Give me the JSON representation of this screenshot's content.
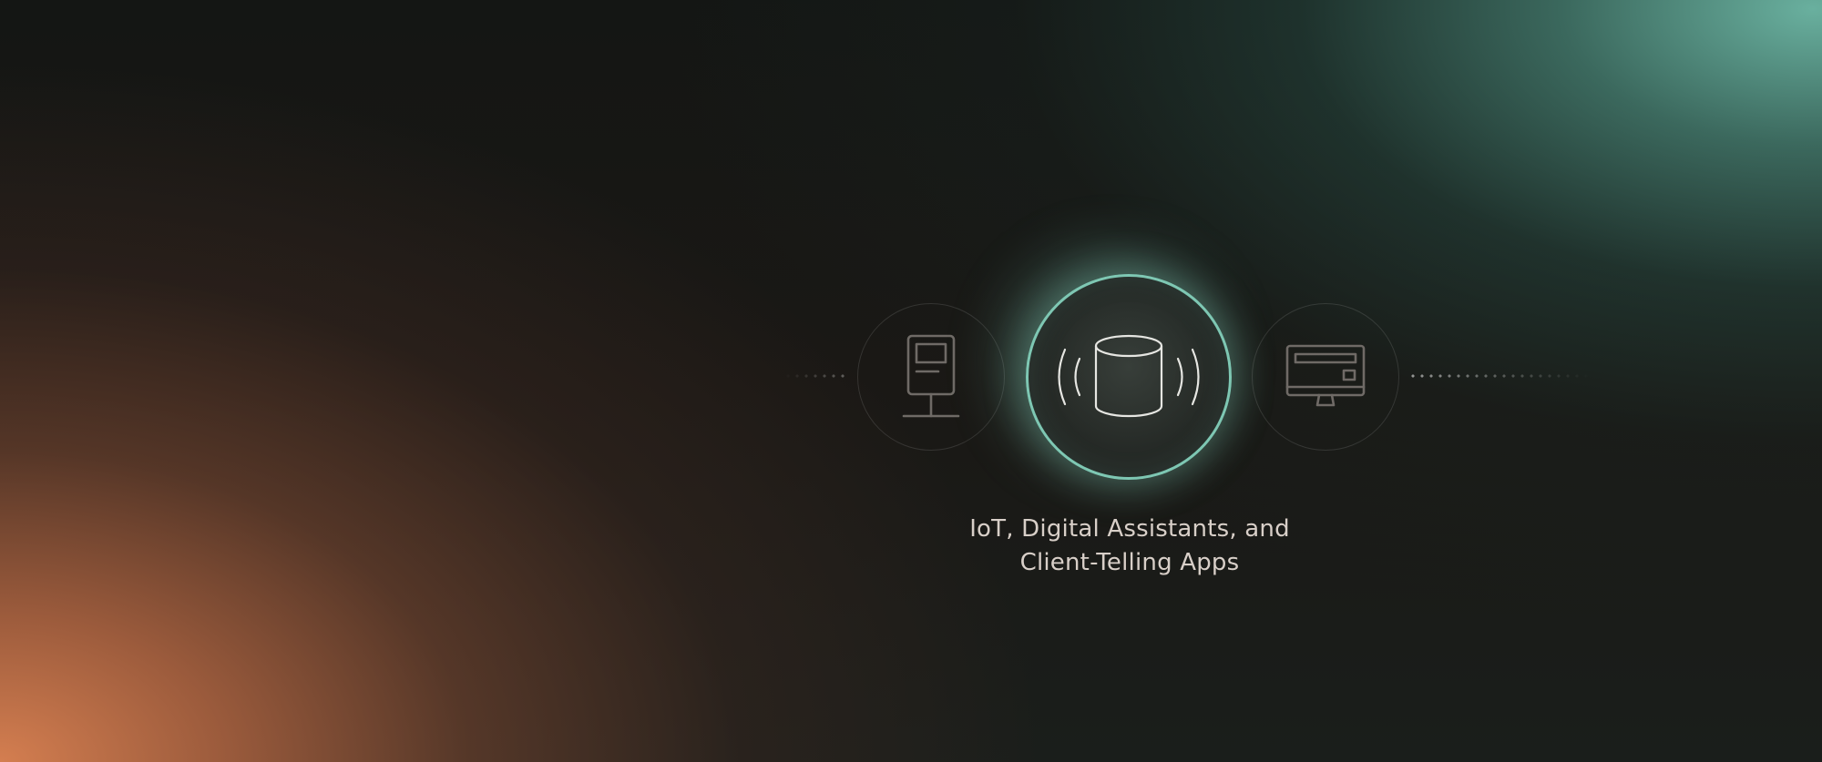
{
  "caption": {
    "line1": "IoT, Digital Assistants, and",
    "line2": "Client-Telling Apps"
  },
  "icons": {
    "left": "kiosk-terminal-icon",
    "center": "smart-speaker-icon",
    "right": "monitor-display-icon"
  },
  "colors": {
    "accent": "#7ec7b3",
    "caption_text": "#d8cfc8",
    "icon_muted": "#6f6a66",
    "icon_active": "#e6e6e2",
    "glow_teal": "#6eb8a6",
    "glow_orange": "#d47e50"
  }
}
